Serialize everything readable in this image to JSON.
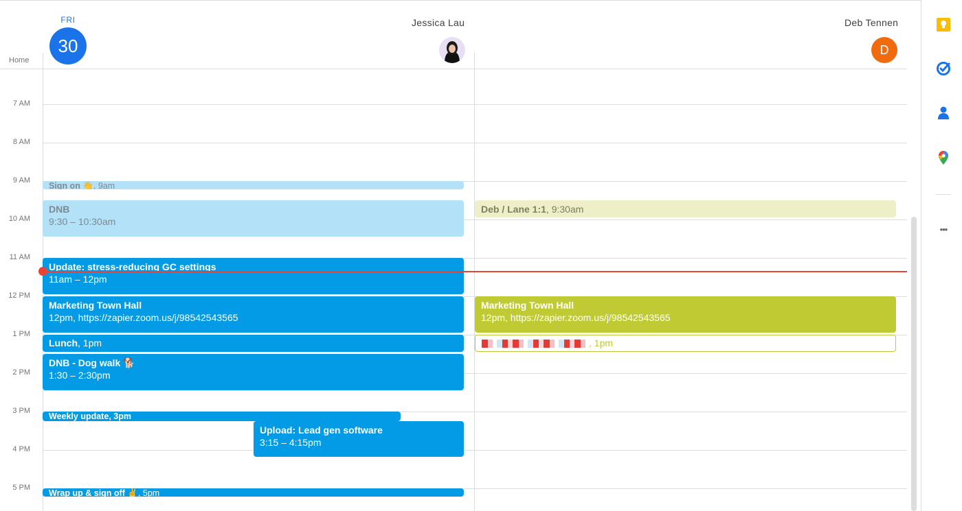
{
  "header": {
    "day_of_week": "FRI",
    "date": "30",
    "timezone_label": "Home",
    "people": [
      {
        "name": "Jessica Lau"
      },
      {
        "name": "Deb Tennen",
        "initial": "D"
      }
    ]
  },
  "hours": [
    "7 AM",
    "8 AM",
    "9 AM",
    "10 AM",
    "11 AM",
    "12 PM",
    "1 PM",
    "2 PM",
    "3 PM",
    "4 PM",
    "5 PM"
  ],
  "events": {
    "jessica": {
      "sign_on": {
        "title": "Sign on 👋",
        "time": ", 9am"
      },
      "dnb": {
        "title": "DNB",
        "time": "9:30 – 10:30am"
      },
      "update": {
        "title": "Update: stress-reducing GC settings",
        "time": "11am – 12pm"
      },
      "town_hall": {
        "title": "Marketing Town Hall",
        "time": "12pm, https://zapier.zoom.us/j/98542543565"
      },
      "lunch": {
        "title": "Lunch",
        "time": ", 1pm"
      },
      "dog_walk": {
        "title": "DNB - Dog walk 🐕",
        "time": "1:30 – 2:30pm"
      },
      "weekly_update": {
        "title": "Weekly update",
        "time": ", 3pm"
      },
      "upload": {
        "title": "Upload: Lead gen software",
        "time": "3:15 – 4:15pm"
      },
      "wrap_up": {
        "title": "Wrap up & sign off ✌️",
        "time": ", 5pm"
      }
    },
    "deb": {
      "one_on_one": {
        "title": "Deb / Lane 1:1",
        "time": ", 9:30am"
      },
      "town_hall": {
        "title": "Marketing Town Hall",
        "time": "12pm, https://zapier.zoom.us/j/98542543565"
      },
      "redacted": {
        "time": ", 1pm"
      }
    }
  },
  "colors": {
    "primary_blue": "#1a73e8",
    "event_blue": "#039be5",
    "event_light_blue": "#b3e1f7",
    "event_olive": "#c0ca33",
    "event_pale_olive": "#eeefc6",
    "now_indicator": "#ea4335",
    "deb_avatar": "#f06b0d"
  },
  "side_panel": {
    "icons": [
      "keep-icon",
      "tasks-icon",
      "contacts-icon",
      "maps-icon",
      "more-icon"
    ],
    "more_label": "•••"
  }
}
